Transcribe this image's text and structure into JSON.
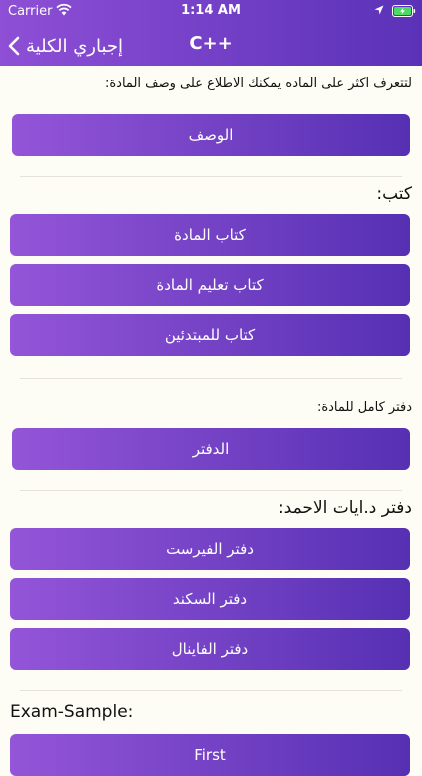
{
  "status_bar": {
    "carrier": "Carrier",
    "time": "1:14 AM"
  },
  "nav": {
    "title": "C++",
    "back_label": "إجباري الكلية"
  },
  "colors": {
    "header_start": "#8e4fd6",
    "header_end": "#5a32b8",
    "button_start": "#9455d8",
    "button_end": "#5630b3",
    "background": "#fdfcf5",
    "battery": "#4cd964"
  },
  "icons": {
    "back": "chevron-left-icon",
    "wifi": "wifi-icon",
    "battery": "battery-charging-icon",
    "location": "location-arrow-icon"
  },
  "description": {
    "intro": "لتتعرف اكثر على الماده يمكنك الاطلاع على وصف المادة:",
    "button": "الوصف"
  },
  "books": {
    "heading": "كتب:",
    "items": [
      "كتاب المادة",
      "كتاب تعليم المادة",
      "كتاب للمبتدئين"
    ]
  },
  "notebook": {
    "heading": "دفتر كامل للمادة:",
    "button": "الدفتر"
  },
  "ahmad_notebooks": {
    "heading": "دفتر د.ايات الاحمد:",
    "items": [
      "دفتر الفيرست",
      "دفتر السكند",
      "دفتر الفاينال"
    ]
  },
  "exam_sample": {
    "heading": "Exam-Sample:",
    "button": "First"
  }
}
